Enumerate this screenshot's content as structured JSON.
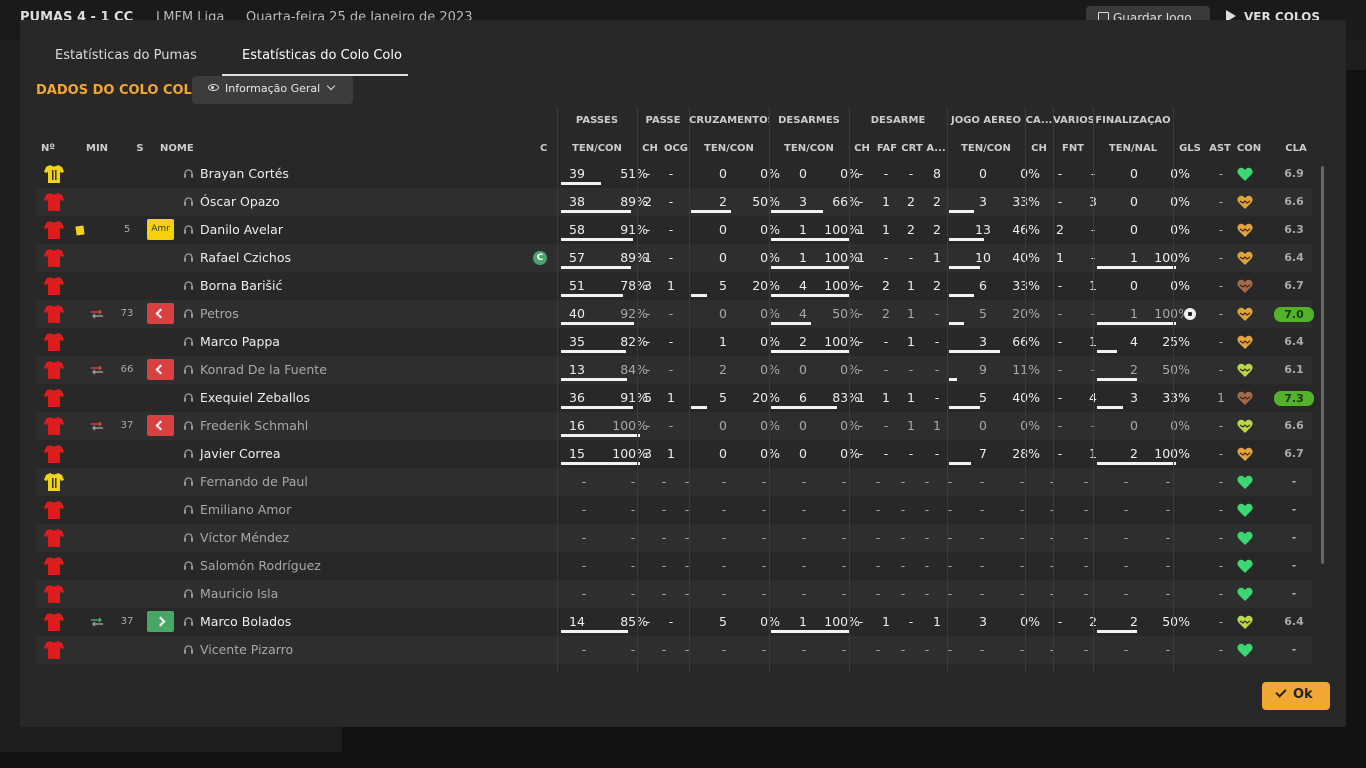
{
  "background": {
    "score": "PUMAS   4 - 1   CC",
    "league": "LMFM Liga",
    "date": "Quarta-feira 25 de Janeiro de 2023",
    "save_label": "Guardar Jogo",
    "view_label": "VER COLOS"
  },
  "tabs": [
    {
      "label": "Estatísticas do Pumas"
    },
    {
      "label": "Estatísticas do Colo Colo"
    }
  ],
  "section_title": "DADOS DO COLO COLO",
  "dropdown_label": "Informação Geral",
  "groups": [
    "PASSES",
    "PASSE",
    "CRUZAMENTOS",
    "DESARMES",
    "DESARME",
    "JOGO AÉREO",
    "CA...",
    "VÁRIOS",
    "FINALIZAÇÃO"
  ],
  "headers": {
    "num": "Nº",
    "min": "MIN",
    "s": "S",
    "name": "NOME",
    "c": "C",
    "passes": "TEN/CON",
    "passe_ch": "CH",
    "passe_ocg": "OCG",
    "cruz": "TEN/CON",
    "desarmes": "TEN/CON",
    "des_ch": "CH",
    "des_faf": "FAF",
    "des_crt": "CRT",
    "des_a": "A...",
    "aereo": "TEN/CON",
    "ca_ch": "CH",
    "fnt": "FNT",
    "final": "TEN/NAL",
    "gls": "GLS",
    "ast": "AST",
    "con": "CON",
    "cla": "CLA"
  },
  "colors": {
    "accent": "#f0a833",
    "shirt_red": "#e01b1b",
    "shirt_gk": "#f2d31a",
    "sub_out": "#d94040",
    "sub_in": "#47a866"
  },
  "ok_label": "Ok",
  "rows": [
    {
      "kit": "gk",
      "min": "",
      "sub": "",
      "card": false,
      "capt": false,
      "name": "Brayan Cortés",
      "faded": false,
      "p_t": "39",
      "p_p": "51%",
      "p_f": 0.51,
      "ch": "-",
      "ocg": "-",
      "cr_t": "0",
      "cr_p": "0%",
      "cr_f": 0,
      "de_t": "0",
      "de_p": "0%",
      "de_f": 0,
      "d_ch": "-",
      "faf": "-",
      "crt": "-",
      "a": "8",
      "ae_t": "0",
      "ae_p": "0%",
      "ae_f": 0,
      "ca": "-",
      "fnt": "-",
      "fi_t": "0",
      "fi_p": "0%",
      "fi_f": 0,
      "gls": "",
      "ast": "-",
      "con": "green",
      "ball": false,
      "cla": "6.9",
      "hi": false
    },
    {
      "kit": "red",
      "min": "",
      "sub": "",
      "card": false,
      "capt": false,
      "name": "Óscar Opazo",
      "faded": false,
      "p_t": "38",
      "p_p": "89%",
      "p_f": 0.89,
      "ch": "2",
      "ocg": "-",
      "cr_t": "2",
      "cr_p": "50%",
      "cr_f": 0.5,
      "de_t": "3",
      "de_p": "66%",
      "de_f": 0.66,
      "d_ch": "-",
      "faf": "1",
      "crt": "2",
      "a": "2",
      "ae_t": "3",
      "ae_p": "33%",
      "ae_f": 0.33,
      "ca": "-",
      "fnt": "3",
      "fi_t": "0",
      "fi_p": "0%",
      "fi_f": 0,
      "gls": "",
      "ast": "-",
      "con": "amber",
      "ball": false,
      "cla": "6.6",
      "hi": false
    },
    {
      "kit": "red",
      "min": "5",
      "sub": "amr",
      "card": true,
      "capt": false,
      "name": "Danilo Avelar",
      "faded": false,
      "p_t": "58",
      "p_p": "91%",
      "p_f": 0.91,
      "ch": "-",
      "ocg": "-",
      "cr_t": "0",
      "cr_p": "0%",
      "cr_f": 0,
      "de_t": "1",
      "de_p": "100%",
      "de_f": 1,
      "d_ch": "1",
      "faf": "1",
      "crt": "2",
      "a": "2",
      "ae_t": "13",
      "ae_p": "46%",
      "ae_f": 0.46,
      "ca": "2",
      "fnt": "-",
      "fi_t": "0",
      "fi_p": "0%",
      "fi_f": 0,
      "gls": "",
      "ast": "-",
      "con": "amber",
      "ball": false,
      "cla": "6.3",
      "hi": false
    },
    {
      "kit": "red",
      "min": "",
      "sub": "",
      "card": false,
      "capt": true,
      "name": "Rafael Czichos",
      "faded": false,
      "p_t": "57",
      "p_p": "89%",
      "p_f": 0.89,
      "ch": "1",
      "ocg": "-",
      "cr_t": "0",
      "cr_p": "0%",
      "cr_f": 0,
      "de_t": "1",
      "de_p": "100%",
      "de_f": 1,
      "d_ch": "1",
      "faf": "-",
      "crt": "-",
      "a": "1",
      "ae_t": "10",
      "ae_p": "40%",
      "ae_f": 0.4,
      "ca": "1",
      "fnt": "-",
      "fi_t": "1",
      "fi_p": "100%",
      "fi_f": 1,
      "gls": "",
      "ast": "-",
      "con": "amber",
      "ball": false,
      "cla": "6.4",
      "hi": false
    },
    {
      "kit": "red",
      "min": "",
      "sub": "",
      "card": false,
      "capt": false,
      "name": "Borna Barišić",
      "faded": false,
      "p_t": "51",
      "p_p": "78%",
      "p_f": 0.78,
      "ch": "3",
      "ocg": "1",
      "cr_t": "5",
      "cr_p": "20%",
      "cr_f": 0.2,
      "de_t": "4",
      "de_p": "100%",
      "de_f": 1,
      "d_ch": "-",
      "faf": "2",
      "crt": "1",
      "a": "2",
      "ae_t": "6",
      "ae_p": "33%",
      "ae_f": 0.33,
      "ca": "-",
      "fnt": "1",
      "fi_t": "0",
      "fi_p": "0%",
      "fi_f": 0,
      "gls": "",
      "ast": "-",
      "con": "brown",
      "ball": false,
      "cla": "6.7",
      "hi": false
    },
    {
      "kit": "red",
      "min": "73",
      "sub": "out",
      "card": false,
      "capt": false,
      "name": "Petros",
      "faded": true,
      "p_t": "40",
      "p_p": "92%",
      "p_f": 0.92,
      "ch": "-",
      "ocg": "-",
      "cr_t": "0",
      "cr_p": "0%",
      "cr_f": 0,
      "de_t": "4",
      "de_p": "50%",
      "de_f": 0.5,
      "d_ch": "-",
      "faf": "2",
      "crt": "1",
      "a": "-",
      "ae_t": "5",
      "ae_p": "20%",
      "ae_f": 0.2,
      "ca": "-",
      "fnt": "-",
      "fi_t": "1",
      "fi_p": "100%",
      "fi_f": 1,
      "gls": "",
      "ast": "-",
      "con": "amber",
      "ball": true,
      "cla": "7.0",
      "hi": true
    },
    {
      "kit": "red",
      "min": "",
      "sub": "",
      "card": false,
      "capt": false,
      "name": "Marco Pappa",
      "faded": false,
      "p_t": "35",
      "p_p": "82%",
      "p_f": 0.82,
      "ch": "-",
      "ocg": "-",
      "cr_t": "1",
      "cr_p": "0%",
      "cr_f": 0,
      "de_t": "2",
      "de_p": "100%",
      "de_f": 1,
      "d_ch": "-",
      "faf": "-",
      "crt": "1",
      "a": "-",
      "ae_t": "3",
      "ae_p": "66%",
      "ae_f": 0.66,
      "ca": "-",
      "fnt": "1",
      "fi_t": "4",
      "fi_p": "25%",
      "fi_f": 0.25,
      "gls": "",
      "ast": "-",
      "con": "amber",
      "ball": false,
      "cla": "6.4",
      "hi": false
    },
    {
      "kit": "red",
      "min": "66",
      "sub": "out",
      "card": false,
      "capt": false,
      "name": "Konrad De la Fuente",
      "faded": true,
      "p_t": "13",
      "p_p": "84%",
      "p_f": 0.84,
      "ch": "-",
      "ocg": "-",
      "cr_t": "2",
      "cr_p": "0%",
      "cr_f": 0,
      "de_t": "0",
      "de_p": "0%",
      "de_f": 0,
      "d_ch": "-",
      "faf": "-",
      "crt": "-",
      "a": "-",
      "ae_t": "9",
      "ae_p": "11%",
      "ae_f": 0.11,
      "ca": "-",
      "fnt": "-",
      "fi_t": "2",
      "fi_p": "50%",
      "fi_f": 0.5,
      "gls": "",
      "ast": "-",
      "con": "lime",
      "ball": false,
      "cla": "6.1",
      "hi": false
    },
    {
      "kit": "red",
      "min": "",
      "sub": "",
      "card": false,
      "capt": false,
      "name": "Exequiel Zeballos",
      "faded": false,
      "p_t": "36",
      "p_p": "91%",
      "p_f": 0.91,
      "ch": "5",
      "ocg": "1",
      "cr_t": "5",
      "cr_p": "20%",
      "cr_f": 0.2,
      "de_t": "6",
      "de_p": "83%",
      "de_f": 0.83,
      "d_ch": "1",
      "faf": "1",
      "crt": "1",
      "a": "-",
      "ae_t": "5",
      "ae_p": "40%",
      "ae_f": 0.4,
      "ca": "-",
      "fnt": "4",
      "fi_t": "3",
      "fi_p": "33%",
      "fi_f": 0.33,
      "gls": "",
      "ast": "1",
      "con": "brown",
      "ball": false,
      "cla": "7.3",
      "hi": true
    },
    {
      "kit": "red",
      "min": "37",
      "sub": "out",
      "card": false,
      "capt": false,
      "name": "Frederik Schmahl",
      "faded": true,
      "p_t": "16",
      "p_p": "100%",
      "p_f": 1,
      "ch": "-",
      "ocg": "-",
      "cr_t": "0",
      "cr_p": "0%",
      "cr_f": 0,
      "de_t": "0",
      "de_p": "0%",
      "de_f": 0,
      "d_ch": "-",
      "faf": "-",
      "crt": "1",
      "a": "1",
      "ae_t": "0",
      "ae_p": "0%",
      "ae_f": 0,
      "ca": "-",
      "fnt": "-",
      "fi_t": "0",
      "fi_p": "0%",
      "fi_f": 0,
      "gls": "",
      "ast": "-",
      "con": "lime",
      "ball": false,
      "cla": "6.6",
      "hi": false
    },
    {
      "kit": "red",
      "min": "",
      "sub": "",
      "card": false,
      "capt": false,
      "name": "Javier Correa",
      "faded": false,
      "p_t": "15",
      "p_p": "100%",
      "p_f": 1,
      "ch": "3",
      "ocg": "1",
      "cr_t": "0",
      "cr_p": "0%",
      "cr_f": 0,
      "de_t": "0",
      "de_p": "0%",
      "de_f": 0,
      "d_ch": "-",
      "faf": "-",
      "crt": "-",
      "a": "-",
      "ae_t": "7",
      "ae_p": "28%",
      "ae_f": 0.28,
      "ca": "-",
      "fnt": "1",
      "fi_t": "2",
      "fi_p": "100%",
      "fi_f": 1,
      "gls": "",
      "ast": "-",
      "con": "amber",
      "ball": false,
      "cla": "6.7",
      "hi": false
    },
    {
      "kit": "gk",
      "min": "",
      "sub": "",
      "card": false,
      "capt": false,
      "name": "Fernando de Paul",
      "faded": true,
      "empty": true,
      "con": "green",
      "cla": "-"
    },
    {
      "kit": "red",
      "min": "",
      "sub": "",
      "card": false,
      "capt": false,
      "name": "Emiliano Amor",
      "faded": true,
      "empty": true,
      "con": "green",
      "cla": "-"
    },
    {
      "kit": "red",
      "min": "",
      "sub": "",
      "card": false,
      "capt": false,
      "name": "Víctor Méndez",
      "faded": true,
      "empty": true,
      "con": "green",
      "cla": "-"
    },
    {
      "kit": "red",
      "min": "",
      "sub": "",
      "card": false,
      "capt": false,
      "name": "Salomón Rodríguez",
      "faded": true,
      "empty": true,
      "con": "green",
      "cla": "-"
    },
    {
      "kit": "red",
      "min": "",
      "sub": "",
      "card": false,
      "capt": false,
      "name": "Mauricio Isla",
      "faded": true,
      "empty": true,
      "con": "green",
      "cla": "-"
    },
    {
      "kit": "red",
      "min": "37",
      "sub": "in",
      "card": false,
      "capt": false,
      "name": "Marco Bolados",
      "faded": false,
      "p_t": "14",
      "p_p": "85%",
      "p_f": 0.85,
      "ch": "-",
      "ocg": "-",
      "cr_t": "5",
      "cr_p": "0%",
      "cr_f": 0,
      "de_t": "1",
      "de_p": "100%",
      "de_f": 1,
      "d_ch": "-",
      "faf": "1",
      "crt": "-",
      "a": "1",
      "ae_t": "3",
      "ae_p": "0%",
      "ae_f": 0,
      "ca": "-",
      "fnt": "2",
      "fi_t": "2",
      "fi_p": "50%",
      "fi_f": 0.5,
      "gls": "",
      "ast": "-",
      "con": "lime",
      "ball": false,
      "cla": "6.4",
      "hi": false
    },
    {
      "kit": "red",
      "min": "",
      "sub": "",
      "card": false,
      "capt": false,
      "name": "Vicente Pizarro",
      "faded": true,
      "empty": true,
      "con": "green",
      "cla": "-"
    }
  ],
  "sub_labels": {
    "amr": "Amr",
    "capt": "C"
  }
}
